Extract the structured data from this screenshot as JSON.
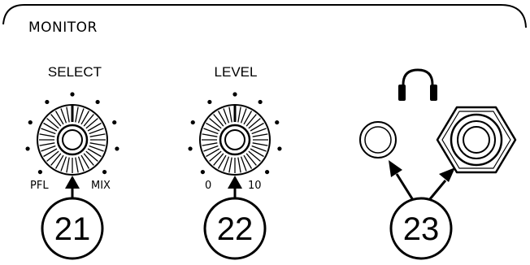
{
  "panel": {
    "title": "MONITOR"
  },
  "knobs": [
    {
      "id": "select",
      "label": "SELECT",
      "min_label": "PFL",
      "max_label": "MIX",
      "callout": "21"
    },
    {
      "id": "level",
      "label": "LEVEL",
      "min_label": "0",
      "max_label": "10",
      "callout": "22"
    }
  ],
  "outputs": {
    "icon": "headphones-icon",
    "callout": "23"
  },
  "colors": {
    "ink": "#000000",
    "background": "#ffffff"
  }
}
